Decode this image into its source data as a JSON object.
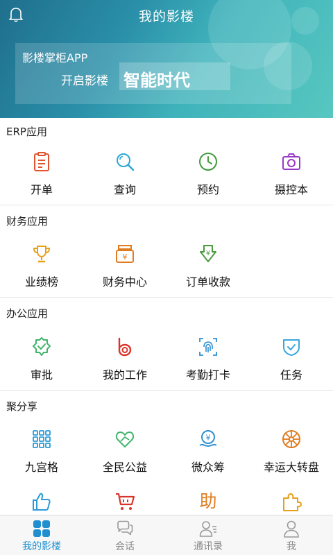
{
  "header": {
    "title": "我的影楼",
    "banner_line1": "影楼掌柜APP",
    "banner_line2": "开启影楼",
    "banner_highlight": "智能时代"
  },
  "sections": [
    {
      "title": "ERP应用",
      "items": [
        {
          "label": "开单",
          "icon": "clipboard-icon",
          "color": "#e0532f"
        },
        {
          "label": "查询",
          "icon": "search-icon",
          "color": "#2aa7d6"
        },
        {
          "label": "预约",
          "icon": "clock-icon",
          "color": "#3f9b3a"
        },
        {
          "label": "摄控本",
          "icon": "camera-icon",
          "color": "#9b39c7"
        }
      ]
    },
    {
      "title": "财务应用",
      "items": [
        {
          "label": "业绩榜",
          "icon": "trophy-icon",
          "color": "#e6a01a"
        },
        {
          "label": "财务中心",
          "icon": "cash-register-icon",
          "color": "#e07c1f"
        },
        {
          "label": "订单收款",
          "icon": "download-yuan-icon",
          "color": "#4a9a3e"
        }
      ]
    },
    {
      "title": "办公应用",
      "items": [
        {
          "label": "审批",
          "icon": "badge-check-icon",
          "color": "#3fb46a"
        },
        {
          "label": "我的工作",
          "icon": "b-letter-icon",
          "color": "#d8342a"
        },
        {
          "label": "考勤打卡",
          "icon": "fingerprint-icon",
          "color": "#2d8ed0"
        },
        {
          "label": "任务",
          "icon": "shield-check-icon",
          "color": "#37a7dc"
        }
      ]
    },
    {
      "title": "聚分享",
      "items": [
        {
          "label": "九宫格",
          "icon": "grid-icon",
          "color": "#2a9bd8"
        },
        {
          "label": "全民公益",
          "icon": "heart-hand-icon",
          "color": "#3fb46a"
        },
        {
          "label": "微众筹",
          "icon": "yuan-hands-icon",
          "color": "#2f8fd1"
        },
        {
          "label": "幸运大转盘",
          "icon": "wheel-icon",
          "color": "#e07c1f"
        }
      ]
    }
  ],
  "partial_row_icons": [
    {
      "icon": "thumbs-up-icon",
      "color": "#2a9bd8"
    },
    {
      "icon": "cart-icon",
      "color": "#d8342a"
    },
    {
      "icon": "zhu-character-icon",
      "text": "助",
      "color": "#e07c1f"
    },
    {
      "icon": "puzzle-icon",
      "color": "#e6a01a"
    }
  ],
  "bottom_nav": [
    {
      "label": "我的影楼",
      "icon": "grid-four-icon",
      "active": true
    },
    {
      "label": "会话",
      "icon": "chat-icon",
      "active": false
    },
    {
      "label": "通讯录",
      "icon": "contacts-icon",
      "active": false
    },
    {
      "label": "我",
      "icon": "person-icon",
      "active": false
    }
  ],
  "colors": {
    "active": "#1f8fcf",
    "inactive": "#888888"
  }
}
